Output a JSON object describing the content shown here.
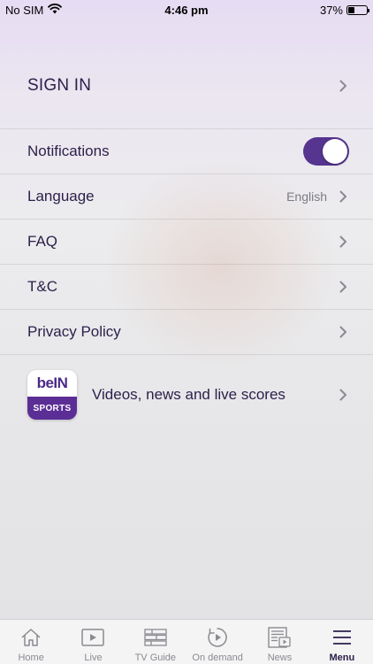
{
  "status_bar": {
    "carrier": "No SIM",
    "time": "4:46 pm",
    "battery_percent": "37%",
    "battery_level": 0.37
  },
  "menu": {
    "sign_in_label": "SIGN IN",
    "notifications": {
      "label": "Notifications",
      "enabled": true
    },
    "language": {
      "label": "Language",
      "value": "English"
    },
    "faq_label": "FAQ",
    "tc_label": "T&C",
    "privacy_label": "Privacy Policy",
    "promo": {
      "icon_logo_text": "beIN",
      "icon_sub_text": "SPORTS",
      "label": "Videos, news and live scores"
    }
  },
  "tab_bar": {
    "tabs": [
      {
        "label": "Home",
        "icon": "home-icon",
        "active": false
      },
      {
        "label": "Live",
        "icon": "play-icon",
        "active": false
      },
      {
        "label": "TV Guide",
        "icon": "tv-guide-icon",
        "active": false
      },
      {
        "label": "On demand",
        "icon": "on-demand-icon",
        "active": false
      },
      {
        "label": "News",
        "icon": "news-icon",
        "active": false
      },
      {
        "label": "Menu",
        "icon": "menu-icon",
        "active": true
      }
    ]
  },
  "colors": {
    "accent": "#563590",
    "text_primary": "#2c1f4a",
    "text_secondary": "#7b7b82",
    "tab_inactive": "#8a8a90"
  }
}
